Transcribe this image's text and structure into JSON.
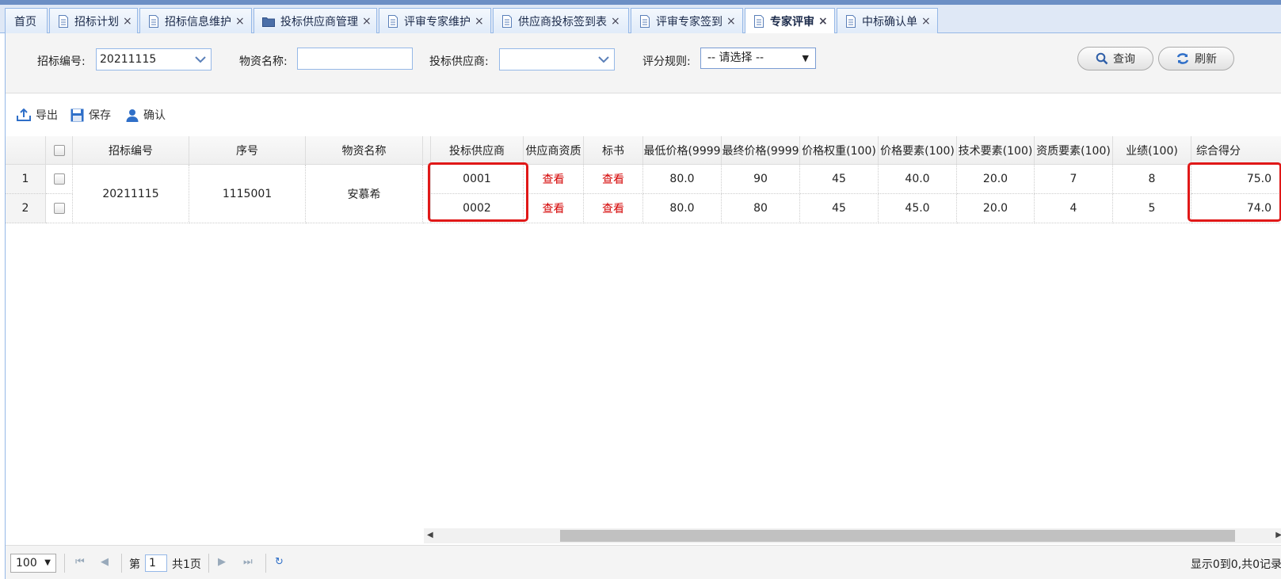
{
  "tabs": [
    {
      "label": "首页",
      "icon": "none"
    },
    {
      "label": "招标计划",
      "icon": "document-icon"
    },
    {
      "label": "招标信息维护",
      "icon": "document-icon"
    },
    {
      "label": "投标供应商管理",
      "icon": "folder-icon"
    },
    {
      "label": "评审专家维护",
      "icon": "document-icon"
    },
    {
      "label": "供应商投标签到表",
      "icon": "document-icon"
    },
    {
      "label": "评审专家签到",
      "icon": "document-icon"
    },
    {
      "label": "专家评审",
      "icon": "document-icon",
      "active": true
    },
    {
      "label": "中标确认单",
      "icon": "document-icon"
    }
  ],
  "tab_close_glyph": "×",
  "search": {
    "bid_no_label": "招标编号:",
    "bid_no_value": "20211115",
    "material_label": "物资名称:",
    "material_value": "",
    "supplier_label": "投标供应商:",
    "supplier_value": "",
    "rule_label": "评分规则:",
    "rule_value": "-- 请选择 --",
    "query_label": "查询",
    "refresh_label": "刷新"
  },
  "toolbar": {
    "export_label": "导出",
    "save_label": "保存",
    "confirm_label": "确认"
  },
  "grid": {
    "headers": [
      "招标编号",
      "序号",
      "物资名称",
      "投标供应商",
      "供应商资质",
      "标书",
      "最低价格(9999",
      "最终价格(9999",
      "价格权重(100)",
      "价格要素(100)",
      "技术要素(100)",
      "资质要素(100)",
      "业绩(100)",
      "综合得分"
    ],
    "merged": {
      "bid_no": "20211115",
      "seq": "1115001",
      "material": "安慕希"
    },
    "rows": [
      {
        "num": "1",
        "supplier": "0001",
        "qualification": "查看",
        "tender": "查看",
        "min_price": "80.0",
        "final_price": "90",
        "price_weight": "45",
        "price_factor": "40.0",
        "tech_factor": "20.0",
        "qual_factor": "7",
        "performance": "8",
        "total": "75.0"
      },
      {
        "num": "2",
        "supplier": "0002",
        "qualification": "查看",
        "tender": "查看",
        "min_price": "80.0",
        "final_price": "80",
        "price_weight": "45",
        "price_factor": "45.0",
        "tech_factor": "20.0",
        "qual_factor": "4",
        "performance": "5",
        "total": "74.0"
      }
    ]
  },
  "pager": {
    "page_size": "100",
    "page_prefix": "第",
    "page_value": "1",
    "page_suffix": "共1页",
    "info": "显示0到0,共0记录"
  },
  "colors": {
    "highlight": "#e01818",
    "link": "#d40000",
    "tab_border": "#95b8e7"
  }
}
